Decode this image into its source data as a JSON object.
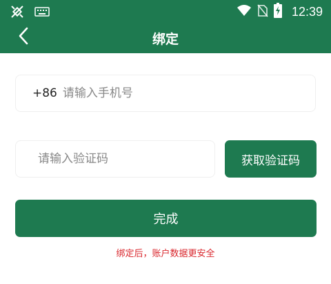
{
  "status_bar": {
    "time": "12:39",
    "icons": [
      "satellite-off-icon",
      "keyboard-icon",
      "wifi-icon",
      "no-sim-icon",
      "battery-charging-icon"
    ]
  },
  "nav": {
    "back_icon": "chevron-left-icon",
    "title": "绑定"
  },
  "form": {
    "country_code": "+86",
    "phone_placeholder": "请输入手机号",
    "code_placeholder": "请输入验证码",
    "get_code_label": "获取验证码",
    "submit_label": "完成",
    "hint": "绑定后，账户数据更安全"
  },
  "colors": {
    "primary": "#1e7a50",
    "hint": "#d9262c"
  }
}
